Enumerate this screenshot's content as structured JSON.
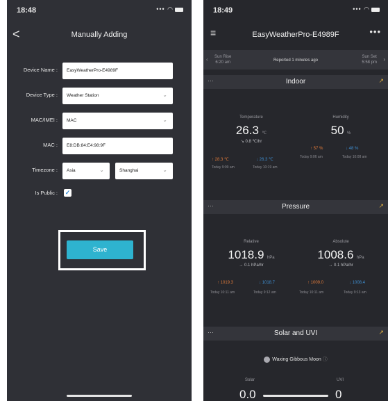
{
  "left": {
    "status": {
      "time": "18:48",
      "icons": "••• ◠"
    },
    "nav": {
      "back": "<",
      "title": "Manually Adding"
    },
    "form": {
      "device_name": {
        "label": "Device Name :",
        "value": "EasyWeatherPro-E4989F"
      },
      "device_type": {
        "label": "Device Type :",
        "value": "Weather Station"
      },
      "mac_imei": {
        "label": "MAC/IMEI :",
        "value": "MAC"
      },
      "mac": {
        "label": "MAC :",
        "value": "E8:DB:84:E4:98:9F"
      },
      "timezone": {
        "label": "Timezone :",
        "region": "Asia",
        "city": "Shanghai"
      },
      "is_public": {
        "label": "Is Public :",
        "check": "✓"
      }
    },
    "save_label": "Save"
  },
  "right": {
    "status": {
      "time": "18:49",
      "icons": "••• ◠"
    },
    "nav": {
      "title": "EasyWeatherPro-E4989F",
      "menu": "≡",
      "more": "•••"
    },
    "sun": {
      "rise_label": "Sun Rise",
      "rise_time": "6:20 am",
      "reported": "Reported 1 minutes ago",
      "set_label": "Sun Set",
      "set_time": "5:58 pm"
    },
    "indoor": {
      "title": "Indoor",
      "temperature": {
        "caption": "Temperature",
        "value": "26.3",
        "unit": "℃",
        "rate": "↘ 0.8 ℃/hr",
        "high": "↑ 28.3 ℃",
        "low": "↓ 26.3 ℃",
        "high_time": "Today 9:09 am",
        "low_time": "Today 10:19 am"
      },
      "humidity": {
        "caption": "Humidity",
        "value": "50",
        "unit": "%",
        "high": "↑ 57 %",
        "low": "↓ 48 %",
        "high_time": "Today 9:06 am",
        "low_time": "Today 10:08 am"
      }
    },
    "pressure": {
      "title": "Pressure",
      "relative": {
        "caption": "Relative",
        "value": "1018.9",
        "unit": "hPa",
        "rate": "→ 0.1 hPa/hr",
        "high": "↑ 1019.3",
        "low": "↓ 1018.7",
        "high_time": "Today 10:11 am",
        "low_time": "Today 9:12 am"
      },
      "absolute": {
        "caption": "Absolute",
        "value": "1008.6",
        "unit": "hPa",
        "rate": "→ 0.1 hPa/hr",
        "high": "↑ 1009.0",
        "low": "↓ 1008.4",
        "high_time": "Today 10:11 am",
        "low_time": "Today 9:13 am"
      }
    },
    "solar": {
      "title": "Solar and UVI",
      "moon": "Waxing Gibbous Moon",
      "solar_caption": "Solar",
      "solar_value": "0.0",
      "uvi_caption": "UVI",
      "uvi_value": "0"
    }
  },
  "colors": {
    "accent": "#2eb3cf",
    "panel": "#2f3036",
    "high": "#e07a3a",
    "low": "#3f8fd2",
    "chart_icon": "#e0b040"
  }
}
